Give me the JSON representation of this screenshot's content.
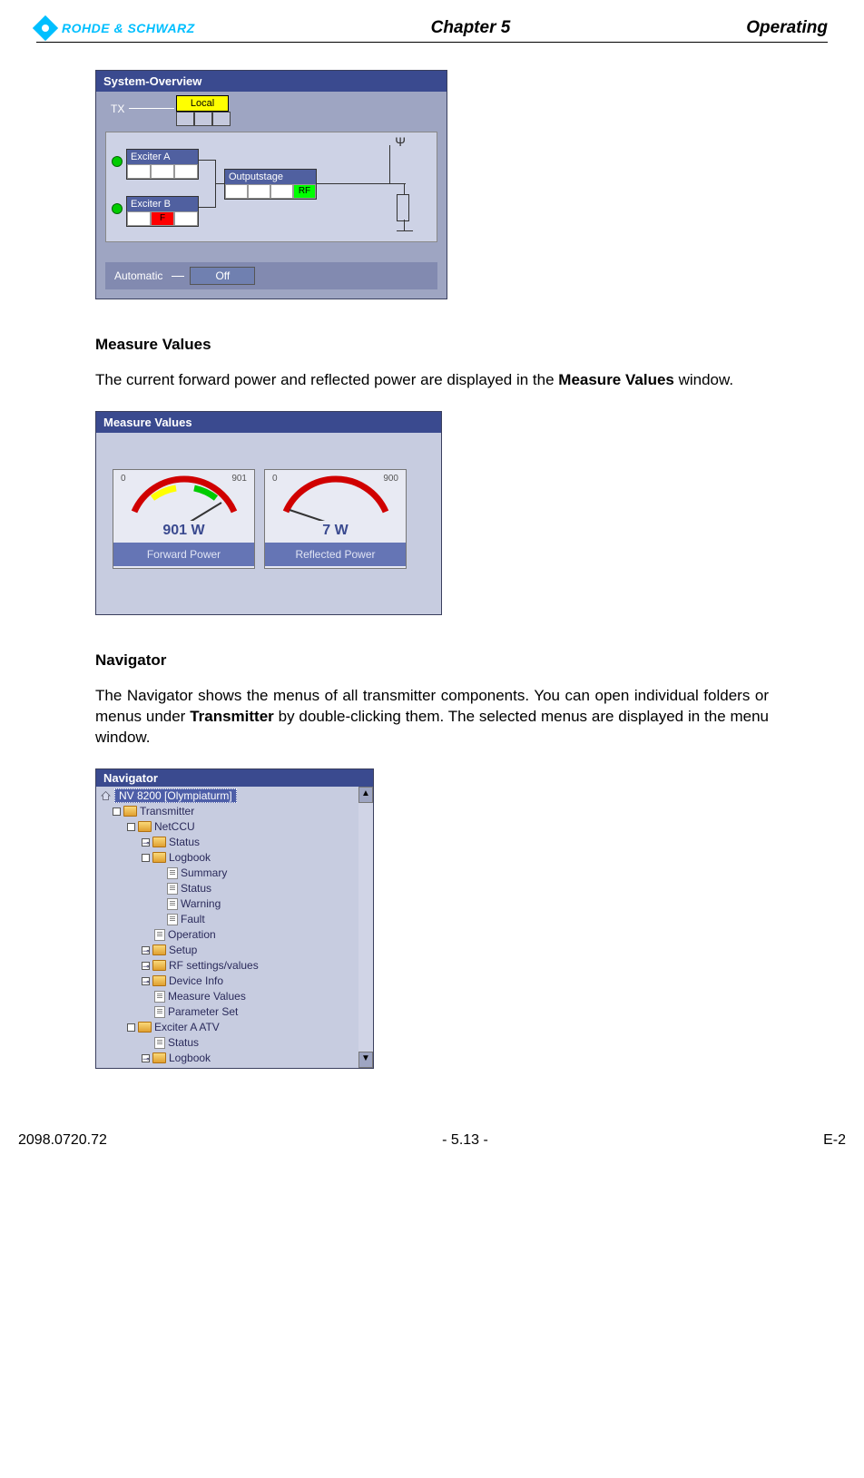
{
  "header": {
    "logo_text": "ROHDE & SCHWARZ",
    "chapter": "Chapter 5",
    "right": "Operating"
  },
  "systemOverview": {
    "title": "System-Overview",
    "tx": "TX",
    "local": "Local",
    "exciterA": "Exciter A",
    "exciterB": "Exciter B",
    "exciterB_cell": "F",
    "outputstage": "Outputstage",
    "outputstage_cell": "RF",
    "automatic": "Automatic",
    "off": "Off"
  },
  "section1": {
    "heading": "Measure Values",
    "text_prefix": "The current forward power and reflected power are displayed in the ",
    "text_bold": "Measure Values",
    "text_suffix": " window."
  },
  "measureValues": {
    "title": "Measure Values",
    "forward": {
      "scale_min": "0",
      "scale_max": "901",
      "value": "901 W",
      "label": "Forward Power"
    },
    "reflected": {
      "scale_min": "0",
      "scale_max": "900",
      "value": "7 W",
      "label": "Reflected Power"
    }
  },
  "section2": {
    "heading": "Navigator",
    "text_prefix": "The Navigator shows the menus of all transmitter components. You can open individual folders or menus under ",
    "text_bold": "Transmitter",
    "text_suffix": " by double-clicking them. The selected menus are displayed in the menu window."
  },
  "navigator": {
    "title": "Navigator",
    "root": "NV 8200 [Olympiaturm]",
    "items": {
      "transmitter": "Transmitter",
      "netccu": "NetCCU",
      "status": "Status",
      "logbook": "Logbook",
      "summary": "Summary",
      "status2": "Status",
      "warning": "Warning",
      "fault": "Fault",
      "operation": "Operation",
      "setup": "Setup",
      "rfsettings": "RF settings/values",
      "deviceinfo": "Device Info",
      "measure": "Measure Values",
      "paramset": "Parameter Set",
      "exciterAatv": "Exciter A ATV",
      "status3": "Status",
      "logbook2": "Logbook"
    }
  },
  "footer": {
    "left": "2098.0720.72",
    "center": "- 5.13 -",
    "right": "E-2"
  }
}
